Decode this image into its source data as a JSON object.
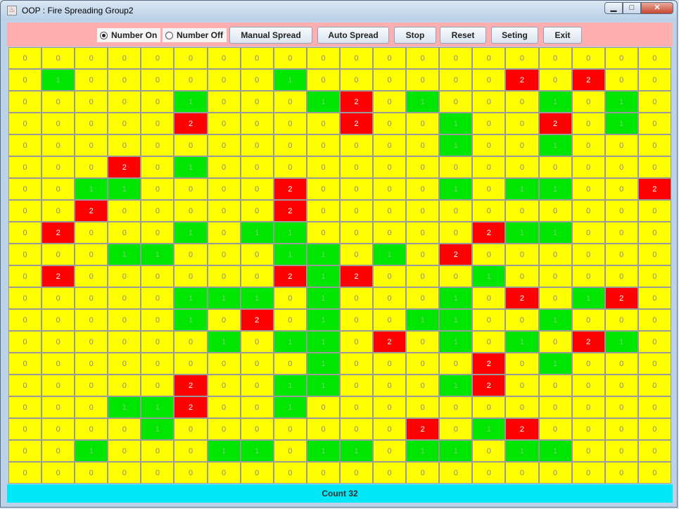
{
  "window": {
    "title": "OOP : Fire Spreading Group2",
    "app_icon": "java-cup-icon",
    "controls": {
      "minimize": "▁",
      "maximize": "□",
      "close": "✕"
    }
  },
  "toolbar": {
    "number_on_label": "Number On",
    "number_off_label": "Number Off",
    "number_on_selected": true,
    "manual_spread_label": "Manual Spread",
    "auto_spread_label": "Auto Spread",
    "stop_label": "Stop",
    "reset_label": "Reset",
    "seting_label": "Seting",
    "exit_label": "Exit"
  },
  "grid": {
    "rows": [
      "00000000000000000000",
      "01000000100000020200",
      "00000100012010001010",
      "00000200002001002010",
      "00000000000001001000",
      "00020100000000000000",
      "00110000200001011002",
      "00200000200000000000",
      "02000101100000211000",
      "00011000110102000000",
      "02000000212000100000",
      "00000111010001020120",
      "00000102010011001000",
      "00000010110201010210",
      "00000000010000201000",
      "00000200110001200000",
      "00011200100000000000",
      "00001000000020120000",
      "00100011011011011000",
      "00000000000000000000"
    ],
    "colors": {
      "0": "#ffff00",
      "1": "#00e600",
      "2": "#ff0000"
    }
  },
  "status": {
    "count_text": "Count 32"
  }
}
